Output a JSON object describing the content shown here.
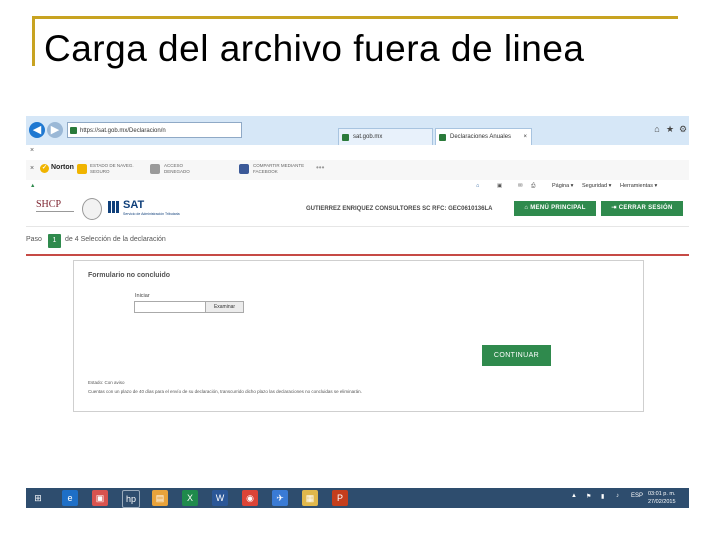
{
  "slide": {
    "title": "Carga del archivo fuera de linea"
  },
  "browser": {
    "address": "https://sat.gob.mx/Declaracion/n",
    "tabs": [
      "sat.gob.mx",
      "Declaraciones Anuales"
    ],
    "notification_close": "×",
    "norton": {
      "brand": "Norton",
      "items": [
        {
          "title": "ESTADO DE NAVEG.",
          "value": "SEGURO"
        },
        {
          "title": "ACCESO",
          "value": "DENEGADO"
        },
        {
          "title": "COMPARTIR MEDIANTE",
          "value": "FACEBOOK"
        }
      ]
    },
    "command_bar": [
      "Página ▾",
      "Seguridad ▾",
      "Herramientas ▾"
    ]
  },
  "sat": {
    "shcp": "SHCP",
    "logo": "SAT",
    "logo_sub": "Servicio de Administración Tributaria",
    "taxpayer": "GUTIERREZ ENRIQUEZ CONSULTORES SC   RFC: GEC0610136LA",
    "menu_principal": "MENÚ PRINCIPAL",
    "cerrar_sesion": "CERRAR SESIÓN"
  },
  "step": {
    "paso": "Paso",
    "number": "1",
    "text": "de 4  Selección de la declaración"
  },
  "form": {
    "title": "Formulario no concluido",
    "iniciar_label": "Iniciar",
    "examinar": "Examinar",
    "continuar": "CONTINUAR",
    "estado": "Estado: Con aviso",
    "aviso": "Cuentas con un plazo de 40 días para el envío de su declaración, transcurrido dicho plazo las declaraciones no concluidas se eliminarán."
  },
  "taskbar": {
    "lang": "ESP",
    "time": "03:01 p. m.",
    "date": "27/02/2015"
  }
}
